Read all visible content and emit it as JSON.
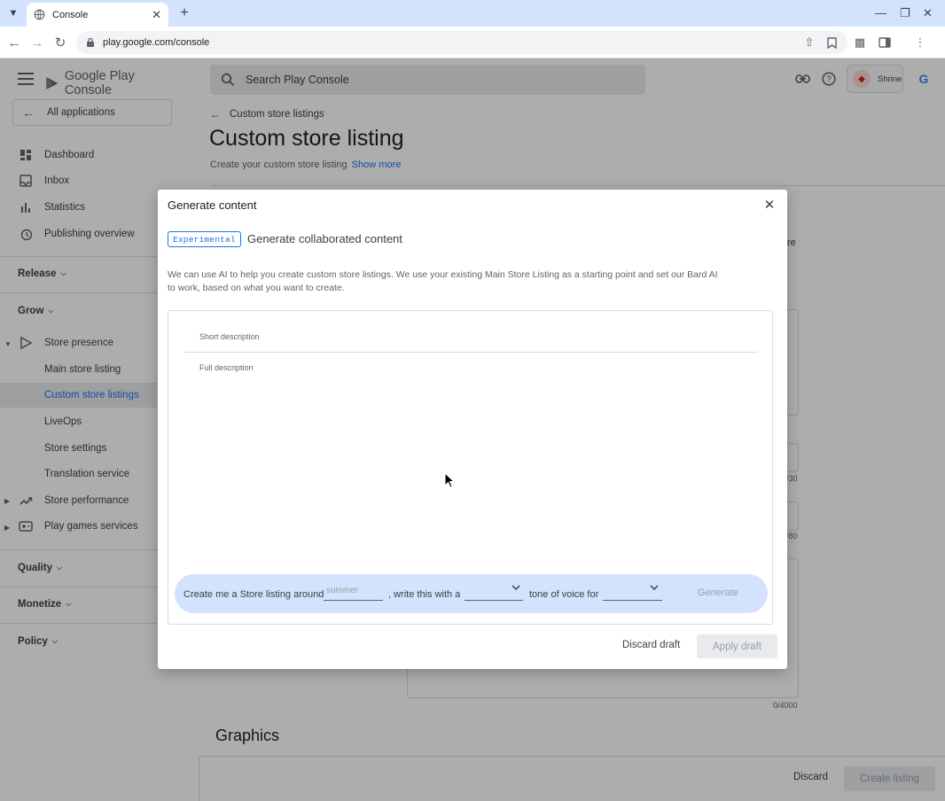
{
  "browser": {
    "tab_title": "Console",
    "url": "play.google.com/console"
  },
  "header": {
    "logo_text": "Google Play Console",
    "search_placeholder": "Search Play Console",
    "account_name": "Shrine",
    "google_letter": "G"
  },
  "sidebar": {
    "back_label": "All applications",
    "items": [
      {
        "label": "Dashboard",
        "icon": "dashboard-icon"
      },
      {
        "label": "Inbox",
        "icon": "inbox-icon"
      },
      {
        "label": "Statistics",
        "icon": "bar-chart-icon"
      },
      {
        "label": "Publishing overview",
        "icon": "history-icon"
      }
    ],
    "sections": {
      "release": "Release",
      "grow": "Grow",
      "quality": "Quality",
      "monetize": "Monetize",
      "policy": "Policy"
    },
    "store_presence": "Store presence",
    "sub_items": [
      "Main store listing",
      "Custom store listings",
      "LiveOps",
      "Store settings",
      "Translation service"
    ],
    "store_performance": "Store performance",
    "play_games": "Play games services"
  },
  "page": {
    "breadcrumb": "Custom store listings",
    "title": "Custom store listing",
    "subtitle": "Create your custom store listing",
    "show_more": "Show more",
    "bg_partial_text": "re",
    "count_30": "/30",
    "count_80": "/80",
    "count_4000": "0/4000",
    "graphics_heading": "Graphics",
    "discard": "Discard",
    "create_listing": "Create listing"
  },
  "dialog": {
    "title": "Generate content",
    "chip": "Experimental",
    "heading": "Generate collaborated content",
    "description": "We can use AI to help you create custom store listings. We use your existing Main Store Listing as a starting point and set our Bard AI to work, based on what you want to create.",
    "short_label": "Short description",
    "full_label": "Full description",
    "prompt": {
      "part1": "Create me a Store listing around",
      "topic_placeholder": "summer",
      "part2": ", write this with a",
      "part3": "tone of voice for",
      "generate": "Generate"
    },
    "discard_draft": "Discard draft",
    "apply_draft": "Apply draft"
  }
}
